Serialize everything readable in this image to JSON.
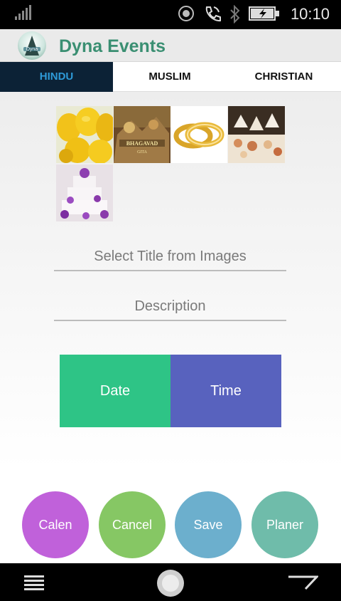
{
  "status_bar": {
    "time": "10:10"
  },
  "app": {
    "title": "Dyna Events",
    "logo_text": "Dyna"
  },
  "tabs": [
    {
      "label": "HINDU",
      "active": true
    },
    {
      "label": "MUSLIM",
      "active": false
    },
    {
      "label": "CHRISTIAN",
      "active": false
    }
  ],
  "images": [
    {
      "name": "lemons-image"
    },
    {
      "name": "bhagavad-gita-image",
      "text": "BHAGAVAD GITA"
    },
    {
      "name": "gold-bangles-image"
    },
    {
      "name": "buffet-table-image"
    },
    {
      "name": "wedding-cake-image"
    }
  ],
  "form": {
    "title_placeholder": "Select Title from Images",
    "description_placeholder": "Description"
  },
  "buttons": {
    "date": "Date",
    "time": "Time",
    "calendar": "Calen",
    "cancel": "Cancel",
    "save": "Save",
    "planner": "Planer"
  },
  "colors": {
    "date": "#2ec486",
    "time": "#5862be",
    "calendar": "#c061da",
    "cancel": "#86c764",
    "save": "#6cafcd",
    "planner": "#6fbcaa",
    "brand": "#3a8f72"
  }
}
